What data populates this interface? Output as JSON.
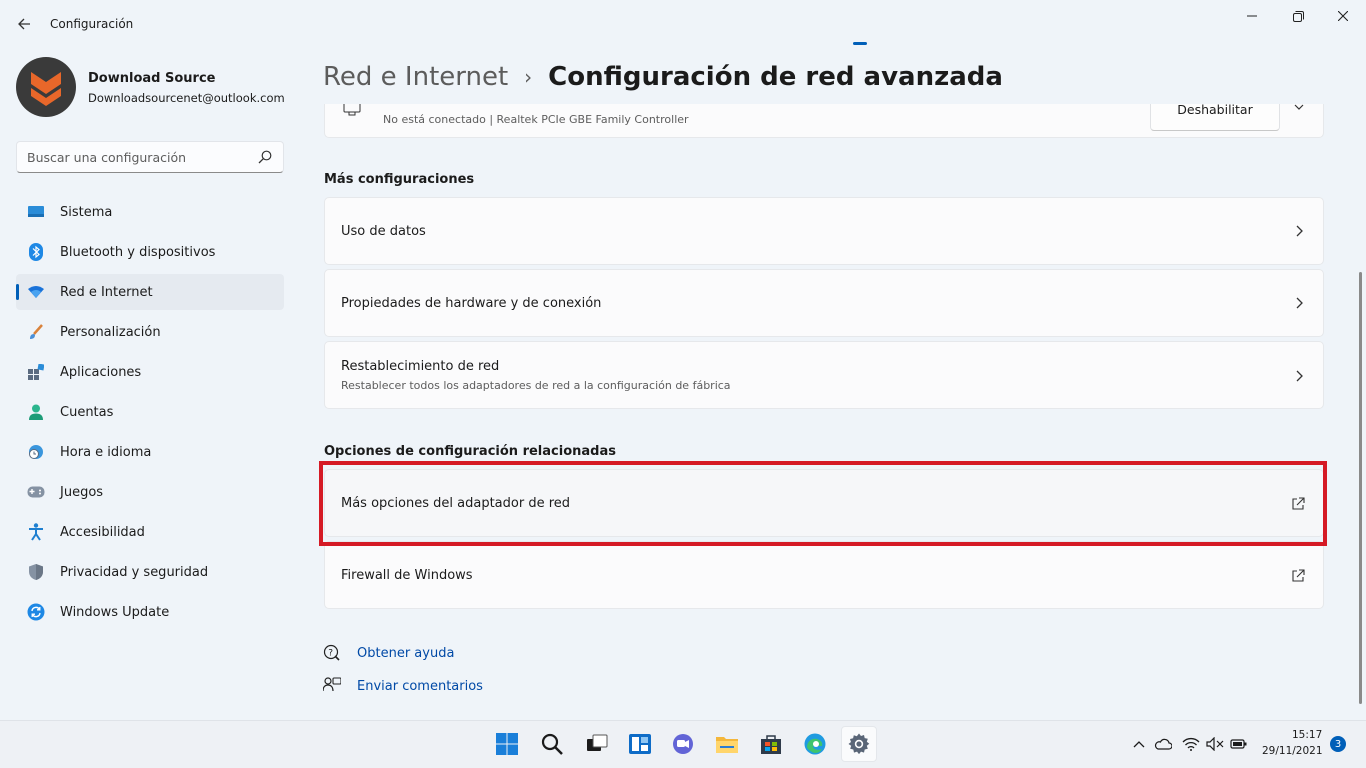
{
  "window": {
    "title": "Configuración",
    "back_icon": "back-arrow-icon",
    "controls": [
      "minimize-icon",
      "restore-icon",
      "close-icon"
    ]
  },
  "profile": {
    "name": "Download Source",
    "email": "Downloadsourcenet@outlook.com",
    "avatar_colors": {
      "bg": "#3a3a3a",
      "logo": "#e8672a"
    }
  },
  "search": {
    "placeholder": "Buscar una configuración",
    "value": ""
  },
  "sidebar": {
    "items": [
      {
        "label": "Sistema",
        "icon": "monitor-icon",
        "selected": false
      },
      {
        "label": "Bluetooth y dispositivos",
        "icon": "bluetooth-icon",
        "selected": false
      },
      {
        "label": "Red e Internet",
        "icon": "wifi-icon",
        "selected": true
      },
      {
        "label": "Personalización",
        "icon": "brush-icon",
        "selected": false
      },
      {
        "label": "Aplicaciones",
        "icon": "apps-icon",
        "selected": false
      },
      {
        "label": "Cuentas",
        "icon": "person-icon",
        "selected": false
      },
      {
        "label": "Hora e idioma",
        "icon": "clock-globe-icon",
        "selected": false
      },
      {
        "label": "Juegos",
        "icon": "gamepad-icon",
        "selected": false
      },
      {
        "label": "Accesibilidad",
        "icon": "accessibility-icon",
        "selected": false
      },
      {
        "label": "Privacidad y seguridad",
        "icon": "shield-icon",
        "selected": false
      },
      {
        "label": "Windows Update",
        "icon": "update-icon",
        "selected": false
      }
    ]
  },
  "header": {
    "parent": "Red e Internet",
    "separator": "›",
    "current": "Configuración de red avanzada"
  },
  "adapter_card": {
    "status": "No está conectado | Realtek PCIe GBE Family Controller",
    "button": "Deshabilitar"
  },
  "more_settings": {
    "title": "Más configuraciones",
    "items": [
      {
        "label": "Uso de datos",
        "sublabel": ""
      },
      {
        "label": "Propiedades de hardware y de conexión",
        "sublabel": ""
      },
      {
        "label": "Restablecimiento de red",
        "sublabel": "Restablecer todos los adaptadores de red a la configuración de fábrica"
      }
    ]
  },
  "related": {
    "title": "Opciones de configuración relacionadas",
    "items": [
      {
        "label": "Más opciones del adaptador de red",
        "icon": "external-link-icon",
        "highlighted": true
      },
      {
        "label": "Firewall de Windows",
        "icon": "external-link-icon",
        "highlighted": false
      }
    ]
  },
  "help": {
    "get_help": "Obtener ayuda",
    "feedback": "Enviar comentarios"
  },
  "taskbar": {
    "apps": [
      "windows-start-icon",
      "search-icon",
      "task-view-icon",
      "widgets-icon",
      "teams-chat-icon",
      "file-explorer-icon",
      "store-icon",
      "edge-icon",
      "settings-gear-icon"
    ],
    "active_app": "settings-gear-icon",
    "tray": [
      "chevron-up-icon",
      "onedrive-cloud-icon",
      "wifi-icon",
      "volume-muted-icon",
      "battery-icon"
    ],
    "time": "15:17",
    "date": "29/11/2021",
    "notifications": "3"
  },
  "colors": {
    "accent": "#005fb8",
    "highlight_border": "#d51a25",
    "background": "#eff4f9",
    "card": "#fbfbfc"
  }
}
